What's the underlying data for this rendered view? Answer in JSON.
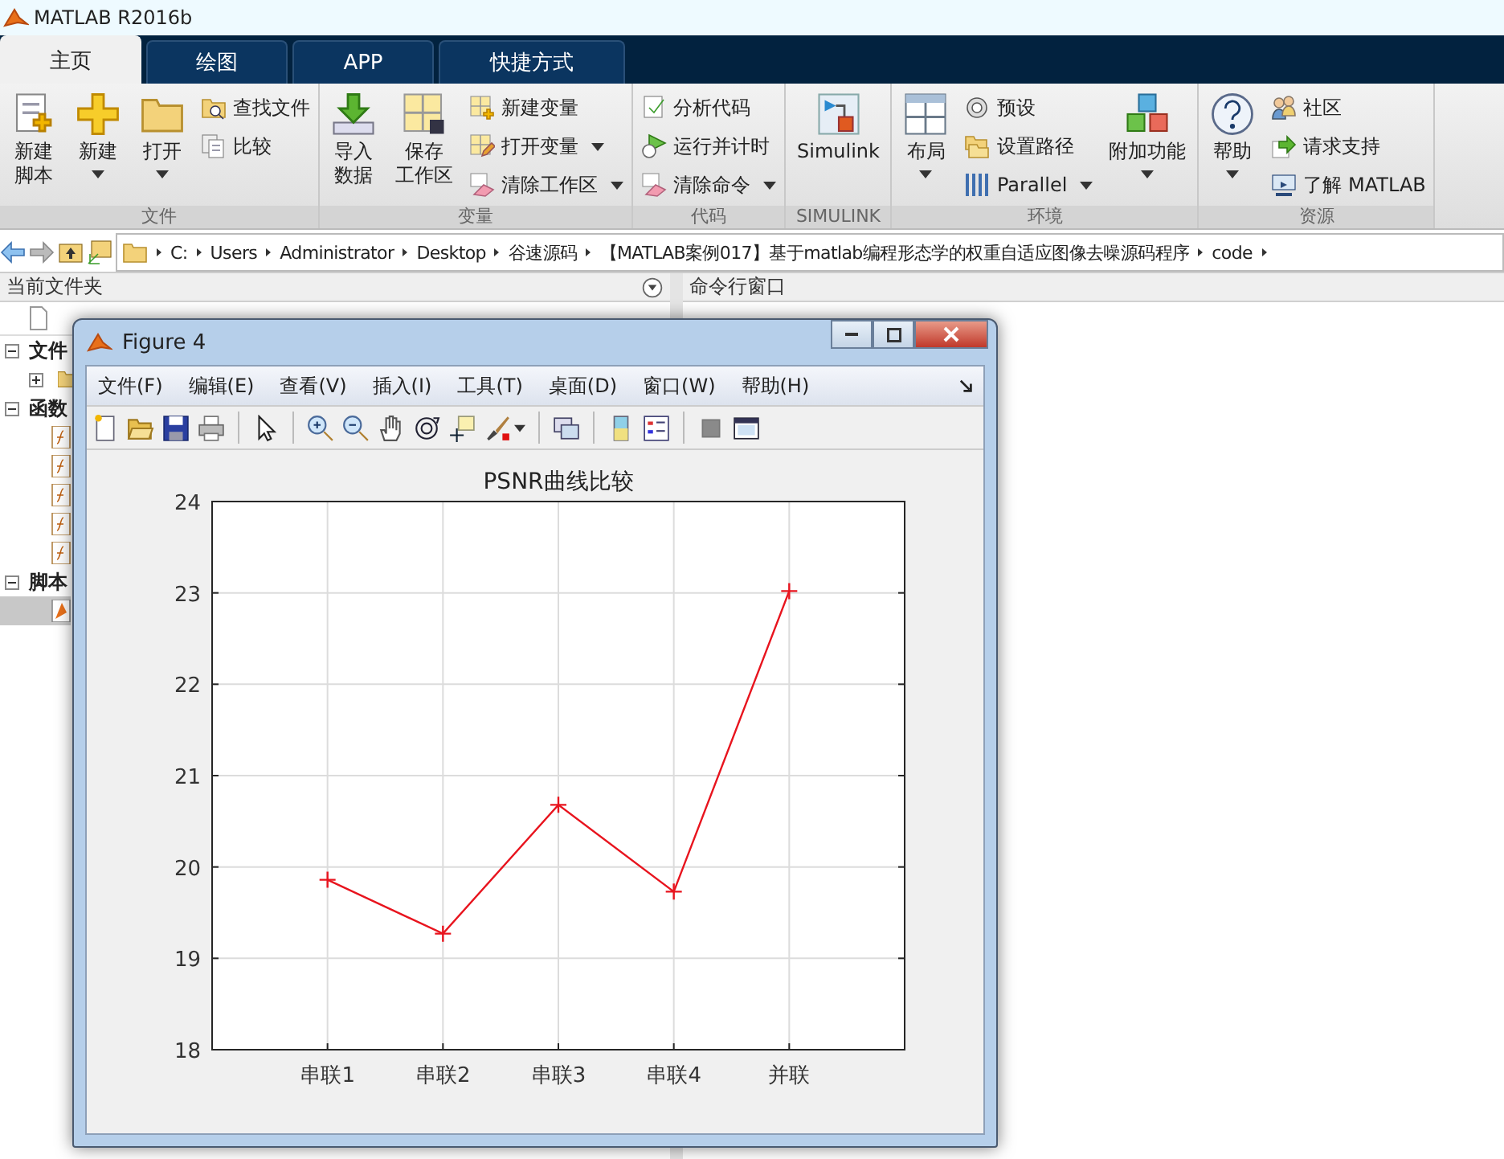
{
  "window": {
    "title": "MATLAB R2016b"
  },
  "tabs": [
    {
      "label": "主页",
      "selected": true
    },
    {
      "label": "绘图",
      "selected": false
    },
    {
      "label": "APP",
      "selected": false
    },
    {
      "label": "快捷方式",
      "selected": false
    }
  ],
  "ribbon": [
    {
      "label": "文件",
      "columns": [
        {
          "kind": "large",
          "lines": [
            "新建",
            "脚本"
          ],
          "menu": false
        },
        {
          "kind": "large",
          "lines": [
            "新建"
          ],
          "menu": true
        },
        {
          "kind": "large",
          "lines": [
            "打开"
          ],
          "menu": true
        },
        {
          "kind": "stack",
          "items": [
            {
              "label": "查找文件",
              "menu": false
            },
            {
              "label": "比较",
              "menu": false
            }
          ]
        }
      ]
    },
    {
      "label": "变量",
      "columns": [
        {
          "kind": "large",
          "lines": [
            "导入",
            "数据"
          ],
          "menu": false
        },
        {
          "kind": "large",
          "lines": [
            "保存",
            "工作区"
          ],
          "menu": false
        },
        {
          "kind": "stack",
          "items": [
            {
              "label": "新建变量",
              "menu": false
            },
            {
              "label": "打开变量",
              "menu": true
            },
            {
              "label": "清除工作区",
              "menu": true
            }
          ]
        }
      ]
    },
    {
      "label": "代码",
      "columns": [
        {
          "kind": "stack",
          "items": [
            {
              "label": "分析代码",
              "menu": false
            },
            {
              "label": "运行并计时",
              "menu": false
            },
            {
              "label": "清除命令",
              "menu": true
            }
          ]
        }
      ]
    },
    {
      "label": "SIMULINK",
      "columns": [
        {
          "kind": "large",
          "lines": [
            "Simulink"
          ],
          "menu": false
        }
      ]
    },
    {
      "label": "环境",
      "columns": [
        {
          "kind": "large",
          "lines": [
            "布局"
          ],
          "menu": true
        },
        {
          "kind": "stack",
          "items": [
            {
              "label": "预设",
              "menu": false
            },
            {
              "label": "设置路径",
              "menu": false
            },
            {
              "label": "Parallel",
              "menu": true
            }
          ]
        },
        {
          "kind": "large",
          "lines": [
            "附加功能"
          ],
          "menu": true
        }
      ]
    },
    {
      "label": "资源",
      "columns": [
        {
          "kind": "large",
          "lines": [
            "帮助"
          ],
          "menu": true
        },
        {
          "kind": "stack",
          "items": [
            {
              "label": "社区",
              "menu": false
            },
            {
              "label": "请求支持",
              "menu": false
            },
            {
              "label": "了解 MATLAB",
              "menu": false
            }
          ]
        }
      ]
    }
  ],
  "address": [
    "C:",
    "Users",
    "Administrator",
    "Desktop",
    "谷速源码",
    "【MATLAB案例017】基于matlab编程形态学的权重自适应图像去噪源码程序",
    "code"
  ],
  "left_panel": {
    "title": "当前文件夹",
    "sections": [
      {
        "label": "文件",
        "expanded": true,
        "items": [
          {
            "kind": "folder",
            "expanded": false,
            "selected": false
          }
        ]
      },
      {
        "label": "函数",
        "expanded": true,
        "items": [
          {
            "kind": "function",
            "selected": false
          },
          {
            "kind": "function",
            "selected": false
          },
          {
            "kind": "function",
            "selected": false
          },
          {
            "kind": "function",
            "selected": false
          },
          {
            "kind": "function",
            "selected": false
          }
        ]
      },
      {
        "label": "脚本",
        "expanded": true,
        "items": [
          {
            "kind": "script",
            "selected": true
          }
        ]
      }
    ]
  },
  "right_panel": {
    "title": "命令行窗口"
  },
  "figure": {
    "title": "Figure 4",
    "menus": [
      "文件(F)",
      "编辑(E)",
      "查看(V)",
      "插入(I)",
      "工具(T)",
      "桌面(D)",
      "窗口(W)",
      "帮助(H)"
    ],
    "chart_data": {
      "type": "line",
      "title": "PSNR曲线比较",
      "categories": [
        "串联1",
        "串联2",
        "串联3",
        "串联4",
        "并联"
      ],
      "series": [
        {
          "color": "#e8141e",
          "marker": "+",
          "values": [
            19.86,
            19.27,
            20.68,
            19.73,
            23.02
          ]
        }
      ],
      "ylim": [
        18,
        24
      ],
      "yticks": [
        18,
        19,
        20,
        21,
        22,
        23,
        24
      ],
      "grid": true
    }
  }
}
